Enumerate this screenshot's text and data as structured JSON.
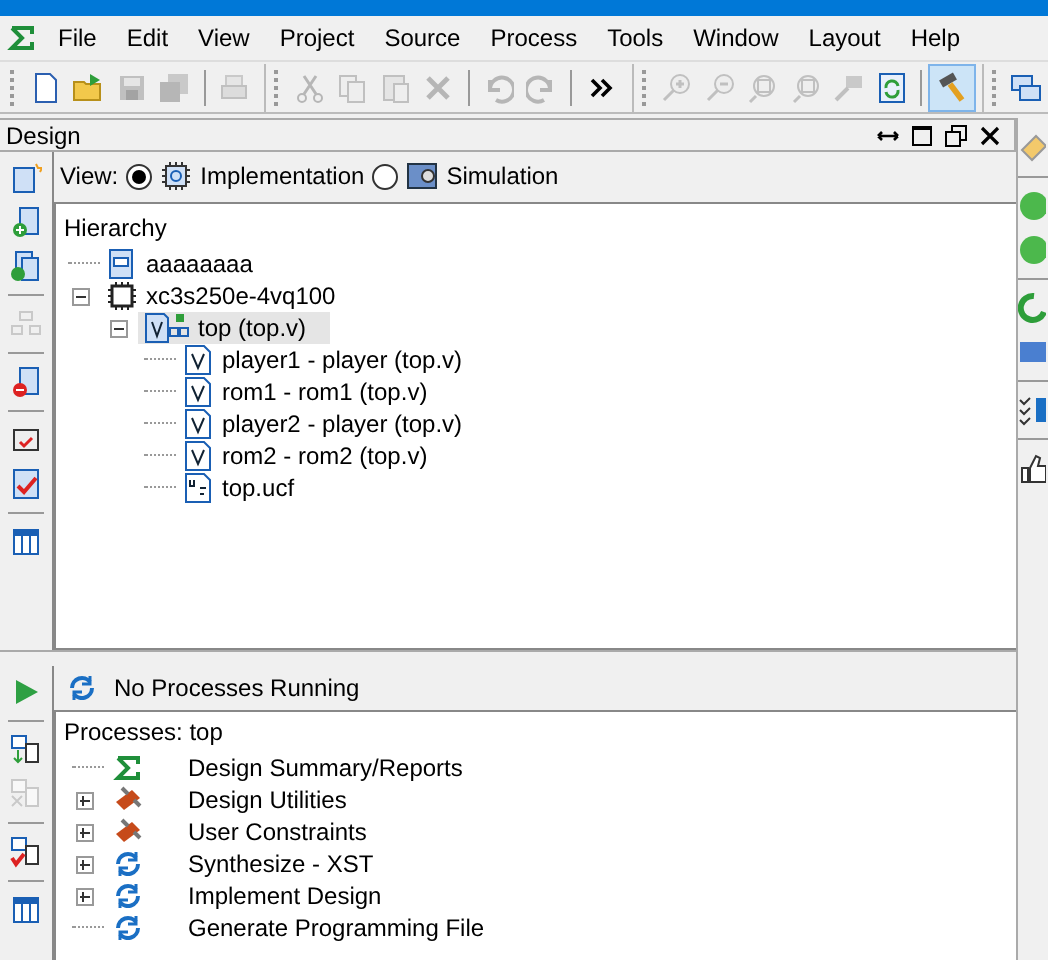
{
  "menu": [
    {
      "label": "File"
    },
    {
      "label": "Edit"
    },
    {
      "label": "View"
    },
    {
      "label": "Project"
    },
    {
      "label": "Source"
    },
    {
      "label": "Process"
    },
    {
      "label": "Tools"
    },
    {
      "label": "Window"
    },
    {
      "label": "Layout"
    },
    {
      "label": "Help"
    }
  ],
  "toolbar": [
    {
      "kind": "new",
      "disabled": false
    },
    {
      "kind": "open",
      "disabled": false
    },
    {
      "kind": "save",
      "disabled": true
    },
    {
      "kind": "saveall",
      "disabled": true
    },
    {
      "kind": "sep"
    },
    {
      "kind": "print",
      "disabled": true
    },
    {
      "kind": "group"
    },
    {
      "kind": "cut",
      "disabled": true
    },
    {
      "kind": "copy",
      "disabled": true
    },
    {
      "kind": "paste",
      "disabled": true
    },
    {
      "kind": "delete",
      "disabled": true
    },
    {
      "kind": "sep"
    },
    {
      "kind": "undo",
      "disabled": true
    },
    {
      "kind": "redo",
      "disabled": true
    },
    {
      "kind": "sep"
    },
    {
      "kind": "more",
      "disabled": false
    },
    {
      "kind": "group"
    },
    {
      "kind": "zoomin",
      "disabled": true
    },
    {
      "kind": "zoomout",
      "disabled": true
    },
    {
      "kind": "zoomfit",
      "disabled": true
    },
    {
      "kind": "zoomfit",
      "disabled": true
    },
    {
      "kind": "zoomsel",
      "disabled": true
    },
    {
      "kind": "refresh",
      "disabled": false
    },
    {
      "kind": "sep"
    },
    {
      "kind": "hammer",
      "disabled": false,
      "selected": true
    },
    {
      "kind": "group"
    },
    {
      "kind": "windows",
      "disabled": false
    }
  ],
  "design_panel": {
    "title": "Design",
    "view": {
      "label": "View:",
      "options": [
        {
          "label": "Implementation",
          "kind": "implementation",
          "selected": true
        },
        {
          "label": "Simulation",
          "kind": "simulation",
          "selected": false
        }
      ]
    },
    "hierarchy": {
      "title": "Hierarchy",
      "items": [
        {
          "label": "aaaaaaaa",
          "kind": "project",
          "selected": false
        },
        {
          "label": "xc3s250e-4vq100",
          "kind": "device",
          "selected": false,
          "expanded": true,
          "children": [
            {
              "label": "top (top.v)",
              "kind": "top",
              "selected": true,
              "expanded": true,
              "children": [
                {
                  "label": "player1 - player (top.v)",
                  "kind": "verilog",
                  "selected": false
                },
                {
                  "label": "rom1 - rom1 (top.v)",
                  "kind": "verilog",
                  "selected": false
                },
                {
                  "label": "player2 - player (top.v)",
                  "kind": "verilog",
                  "selected": false
                },
                {
                  "label": "rom2 - rom2 (top.v)",
                  "kind": "verilog",
                  "selected": false
                },
                {
                  "label": "top.ucf",
                  "kind": "ucf",
                  "selected": false
                }
              ]
            }
          ]
        }
      ]
    },
    "side_tools": [
      {
        "kind": "newsrc",
        "disabled": false
      },
      {
        "kind": "addsrc",
        "disabled": false
      },
      {
        "kind": "addcopy",
        "disabled": false
      },
      {
        "kind": "sep"
      },
      {
        "kind": "module",
        "disabled": true
      },
      {
        "kind": "sep"
      },
      {
        "kind": "removesrc",
        "disabled": false
      },
      {
        "kind": "sep"
      },
      {
        "kind": "chipcheck",
        "disabled": false
      },
      {
        "kind": "doccheck",
        "disabled": false
      },
      {
        "kind": "sep"
      },
      {
        "kind": "table",
        "disabled": false
      }
    ]
  },
  "process_panel": {
    "status": "No Processes Running",
    "title": "Processes: top",
    "items": [
      {
        "label": "Design Summary/Reports",
        "kind": "summary",
        "expandable": false
      },
      {
        "label": "Design Utilities",
        "kind": "tools",
        "expandable": true
      },
      {
        "label": "User Constraints",
        "kind": "tools",
        "expandable": true
      },
      {
        "label": "Synthesize - XST",
        "kind": "sync",
        "expandable": true
      },
      {
        "label": "Implement Design",
        "kind": "sync",
        "expandable": true
      },
      {
        "label": "Generate Programming File",
        "kind": "sync",
        "expandable": false
      }
    ],
    "side_tools": [
      {
        "kind": "run",
        "disabled": false
      },
      {
        "kind": "sep"
      },
      {
        "kind": "chipdown",
        "disabled": false
      },
      {
        "kind": "chipx",
        "disabled": true
      },
      {
        "kind": "sep"
      },
      {
        "kind": "chipok",
        "disabled": false
      },
      {
        "kind": "sep"
      },
      {
        "kind": "table",
        "disabled": false
      }
    ]
  }
}
